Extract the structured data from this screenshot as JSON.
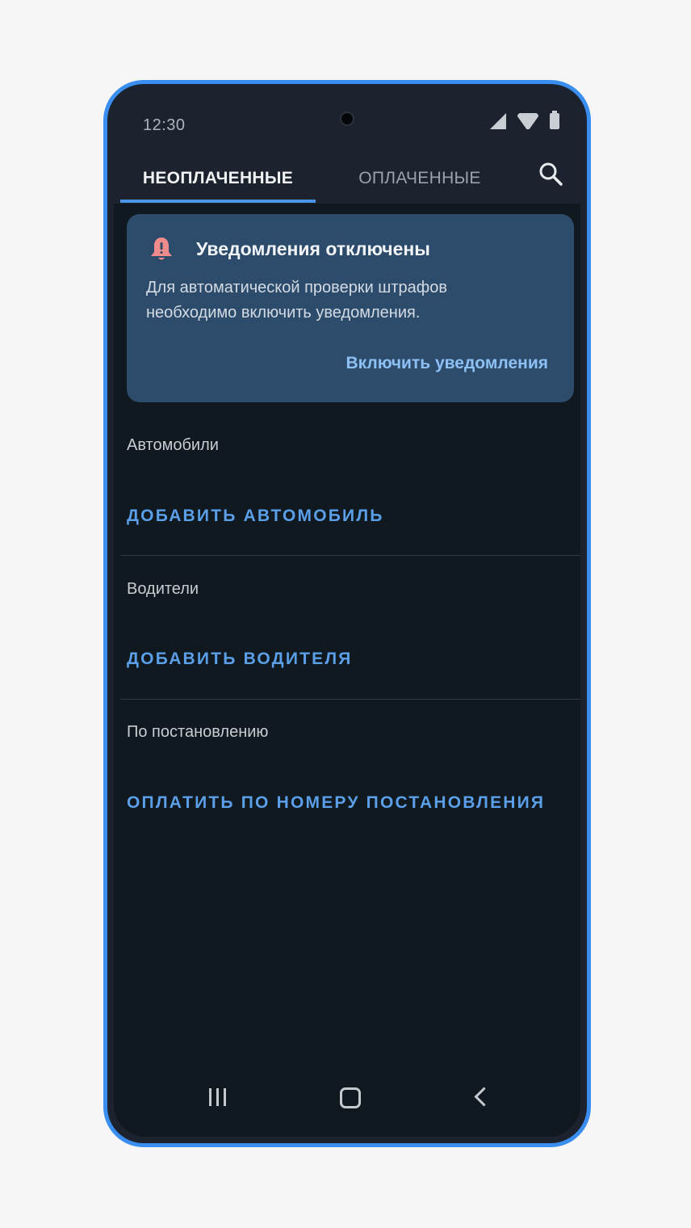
{
  "status_bar": {
    "time": "12:30"
  },
  "tabs": [
    {
      "label": "НЕОПЛАЧЕННЫЕ",
      "active": true
    },
    {
      "label": "ОПЛАЧЕННЫЕ",
      "active": false
    }
  ],
  "notice": {
    "title": "Уведомления отключены",
    "body": "Для автоматической проверки штрафов необходимо включить уведомления.",
    "action": "Включить уведомления"
  },
  "sections": {
    "cars": {
      "label": "Автомобили",
      "action": "ДОБАВИТЬ АВТОМОБИЛЬ"
    },
    "drivers": {
      "label": "Водители",
      "action": "ДОБАВИТЬ ВОДИТЕЛЯ"
    },
    "resolution": {
      "label": "По постановлению",
      "action": "ОПЛАТИТЬ ПО НОМЕРУ ПОСТАНОВЛЕНИЯ"
    }
  },
  "colors": {
    "accent": "#4c95e6",
    "device_frame": "#3a8ef0",
    "background": "#101820",
    "notice_bg": "#2d4b6a",
    "bell": "#f08b8b"
  },
  "icons": {
    "search": "search-icon",
    "bell": "bell-alert-icon",
    "signal": "signal-icon",
    "wifi": "wifi-icon",
    "battery": "battery-icon",
    "recent": "recent-apps-icon",
    "home": "home-icon",
    "back": "back-icon"
  }
}
